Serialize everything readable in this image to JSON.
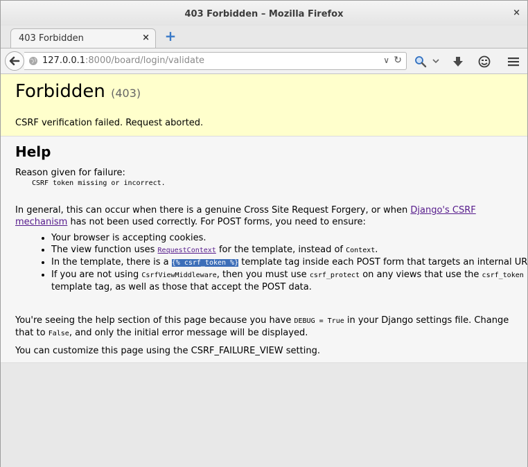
{
  "window": {
    "title": "403 Forbidden – Mozilla Firefox",
    "close_glyph": "×"
  },
  "tabs": [
    {
      "label": "403 Forbidden",
      "close_glyph": "×"
    }
  ],
  "newtab_glyph": "+",
  "navbar": {
    "url_host": "127.0.0.1",
    "url_rest": ":8000/board/login/validate",
    "dropdown_glyph": "∨",
    "reload_glyph": "↻",
    "icons": [
      "back-arrow-icon",
      "globe-icon",
      "search-icon",
      "download-icon",
      "smiley-icon",
      "hamburger-menu-icon"
    ]
  },
  "summary": {
    "heading": "Forbidden",
    "code": "(403)",
    "message": "CSRF verification failed. Request aborted."
  },
  "help": {
    "heading": "Help",
    "reason_label": "Reason given for failure:",
    "reason_code": "CSRF token missing or incorrect.",
    "intro_prefix": "In general, this can occur when there is a genuine Cross Site Request Forgery, or when ",
    "intro_link": "Django's CSRF mechanism",
    "intro_suffix": " has not been used correctly. For POST forms, you need to ensure:",
    "bullet1": "Your browser is accepting cookies.",
    "bullet2_prefix": "The view function uses ",
    "bullet2_link": "RequestContext",
    "bullet2_mid": " for the template, instead of ",
    "bullet2_code": "Context",
    "bullet2_suffix": ".",
    "bullet3_prefix": "In the template, there is a ",
    "bullet3_code": "{% csrf_token %}",
    "bullet3_suffix": " template tag inside each POST form that targets an internal URL.",
    "bullet4_prefix": "If you are not using ",
    "bullet4_code1": "CsrfViewMiddleware",
    "bullet4_mid": ", then you must use ",
    "bullet4_code2": "csrf_protect",
    "bullet4_mid2": " on any views that use the ",
    "bullet4_code3": "csrf_token",
    "bullet4_suffix": " template tag, as well as those that accept the POST data.",
    "debug_prefix": "You're seeing the help section of this page because you have ",
    "debug_code": "DEBUG = True",
    "debug_mid": " in your Django settings file. Change that to ",
    "debug_code2": "False",
    "debug_suffix": ", and only the initial error message will be displayed.",
    "customize": "You can customize this page using the CSRF_FAILURE_VIEW setting."
  }
}
